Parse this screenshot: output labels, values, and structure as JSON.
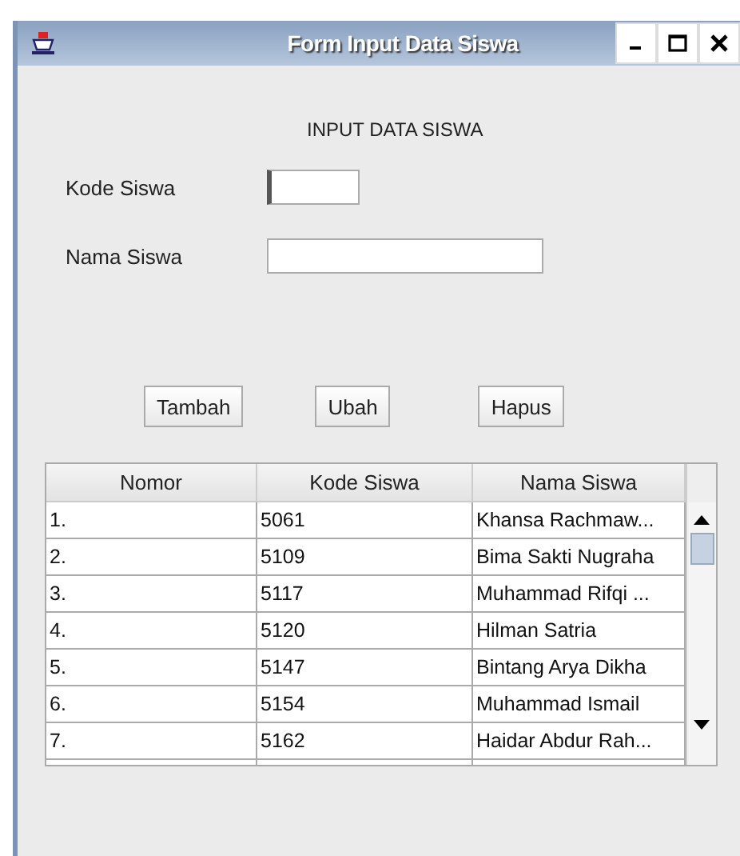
{
  "window": {
    "title": "Form Input Data Siswa"
  },
  "heading": "INPUT DATA SISWA",
  "fields": [
    {
      "label": "Kode Siswa",
      "focused": true
    },
    {
      "label": "Nama Siswa",
      "focused": false
    }
  ],
  "buttons": [
    "Tambah",
    "Ubah",
    "Hapus"
  ],
  "table": {
    "columns": [
      "Nomor",
      "Kode Siswa",
      "Nama Siswa"
    ],
    "rows": [
      [
        "1.",
        "5061",
        "Khansa Rachmaw..."
      ],
      [
        "2.",
        "5109",
        "Bima Sakti Nugraha"
      ],
      [
        "3.",
        "5117",
        "Muhammad Rifqi ..."
      ],
      [
        "4.",
        "5120",
        "Hilman Satria"
      ],
      [
        "5.",
        "5147",
        "Bintang Arya Dikha"
      ],
      [
        "6.",
        "5154",
        "Muhammad Ismail"
      ],
      [
        "7.",
        "5162",
        "Haidar Abdur Rah..."
      ]
    ]
  }
}
